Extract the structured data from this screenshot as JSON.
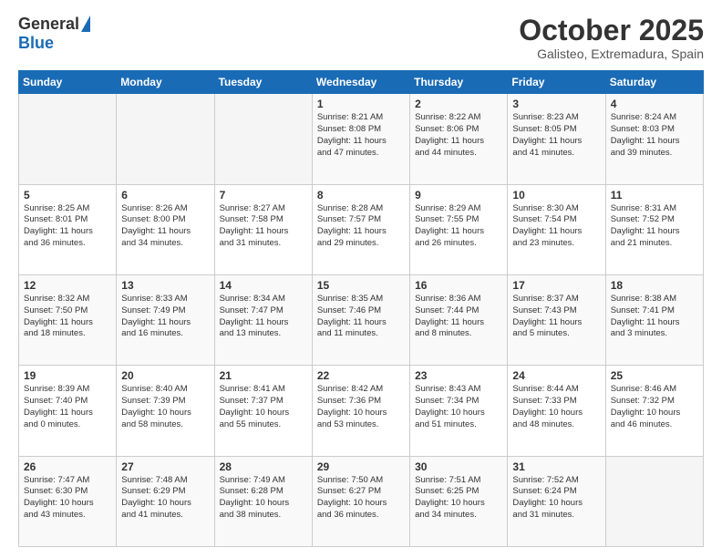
{
  "header": {
    "logo_general": "General",
    "logo_blue": "Blue",
    "month_title": "October 2025",
    "location": "Galisteo, Extremadura, Spain"
  },
  "weekdays": [
    "Sunday",
    "Monday",
    "Tuesday",
    "Wednesday",
    "Thursday",
    "Friday",
    "Saturday"
  ],
  "weeks": [
    [
      {
        "day": "",
        "info": ""
      },
      {
        "day": "",
        "info": ""
      },
      {
        "day": "",
        "info": ""
      },
      {
        "day": "1",
        "info": "Sunrise: 8:21 AM\nSunset: 8:08 PM\nDaylight: 11 hours\nand 47 minutes."
      },
      {
        "day": "2",
        "info": "Sunrise: 8:22 AM\nSunset: 8:06 PM\nDaylight: 11 hours\nand 44 minutes."
      },
      {
        "day": "3",
        "info": "Sunrise: 8:23 AM\nSunset: 8:05 PM\nDaylight: 11 hours\nand 41 minutes."
      },
      {
        "day": "4",
        "info": "Sunrise: 8:24 AM\nSunset: 8:03 PM\nDaylight: 11 hours\nand 39 minutes."
      }
    ],
    [
      {
        "day": "5",
        "info": "Sunrise: 8:25 AM\nSunset: 8:01 PM\nDaylight: 11 hours\nand 36 minutes."
      },
      {
        "day": "6",
        "info": "Sunrise: 8:26 AM\nSunset: 8:00 PM\nDaylight: 11 hours\nand 34 minutes."
      },
      {
        "day": "7",
        "info": "Sunrise: 8:27 AM\nSunset: 7:58 PM\nDaylight: 11 hours\nand 31 minutes."
      },
      {
        "day": "8",
        "info": "Sunrise: 8:28 AM\nSunset: 7:57 PM\nDaylight: 11 hours\nand 29 minutes."
      },
      {
        "day": "9",
        "info": "Sunrise: 8:29 AM\nSunset: 7:55 PM\nDaylight: 11 hours\nand 26 minutes."
      },
      {
        "day": "10",
        "info": "Sunrise: 8:30 AM\nSunset: 7:54 PM\nDaylight: 11 hours\nand 23 minutes."
      },
      {
        "day": "11",
        "info": "Sunrise: 8:31 AM\nSunset: 7:52 PM\nDaylight: 11 hours\nand 21 minutes."
      }
    ],
    [
      {
        "day": "12",
        "info": "Sunrise: 8:32 AM\nSunset: 7:50 PM\nDaylight: 11 hours\nand 18 minutes."
      },
      {
        "day": "13",
        "info": "Sunrise: 8:33 AM\nSunset: 7:49 PM\nDaylight: 11 hours\nand 16 minutes."
      },
      {
        "day": "14",
        "info": "Sunrise: 8:34 AM\nSunset: 7:47 PM\nDaylight: 11 hours\nand 13 minutes."
      },
      {
        "day": "15",
        "info": "Sunrise: 8:35 AM\nSunset: 7:46 PM\nDaylight: 11 hours\nand 11 minutes."
      },
      {
        "day": "16",
        "info": "Sunrise: 8:36 AM\nSunset: 7:44 PM\nDaylight: 11 hours\nand 8 minutes."
      },
      {
        "day": "17",
        "info": "Sunrise: 8:37 AM\nSunset: 7:43 PM\nDaylight: 11 hours\nand 5 minutes."
      },
      {
        "day": "18",
        "info": "Sunrise: 8:38 AM\nSunset: 7:41 PM\nDaylight: 11 hours\nand 3 minutes."
      }
    ],
    [
      {
        "day": "19",
        "info": "Sunrise: 8:39 AM\nSunset: 7:40 PM\nDaylight: 11 hours\nand 0 minutes."
      },
      {
        "day": "20",
        "info": "Sunrise: 8:40 AM\nSunset: 7:39 PM\nDaylight: 10 hours\nand 58 minutes."
      },
      {
        "day": "21",
        "info": "Sunrise: 8:41 AM\nSunset: 7:37 PM\nDaylight: 10 hours\nand 55 minutes."
      },
      {
        "day": "22",
        "info": "Sunrise: 8:42 AM\nSunset: 7:36 PM\nDaylight: 10 hours\nand 53 minutes."
      },
      {
        "day": "23",
        "info": "Sunrise: 8:43 AM\nSunset: 7:34 PM\nDaylight: 10 hours\nand 51 minutes."
      },
      {
        "day": "24",
        "info": "Sunrise: 8:44 AM\nSunset: 7:33 PM\nDaylight: 10 hours\nand 48 minutes."
      },
      {
        "day": "25",
        "info": "Sunrise: 8:46 AM\nSunset: 7:32 PM\nDaylight: 10 hours\nand 46 minutes."
      }
    ],
    [
      {
        "day": "26",
        "info": "Sunrise: 7:47 AM\nSunset: 6:30 PM\nDaylight: 10 hours\nand 43 minutes."
      },
      {
        "day": "27",
        "info": "Sunrise: 7:48 AM\nSunset: 6:29 PM\nDaylight: 10 hours\nand 41 minutes."
      },
      {
        "day": "28",
        "info": "Sunrise: 7:49 AM\nSunset: 6:28 PM\nDaylight: 10 hours\nand 38 minutes."
      },
      {
        "day": "29",
        "info": "Sunrise: 7:50 AM\nSunset: 6:27 PM\nDaylight: 10 hours\nand 36 minutes."
      },
      {
        "day": "30",
        "info": "Sunrise: 7:51 AM\nSunset: 6:25 PM\nDaylight: 10 hours\nand 34 minutes."
      },
      {
        "day": "31",
        "info": "Sunrise: 7:52 AM\nSunset: 6:24 PM\nDaylight: 10 hours\nand 31 minutes."
      },
      {
        "day": "",
        "info": ""
      }
    ]
  ]
}
